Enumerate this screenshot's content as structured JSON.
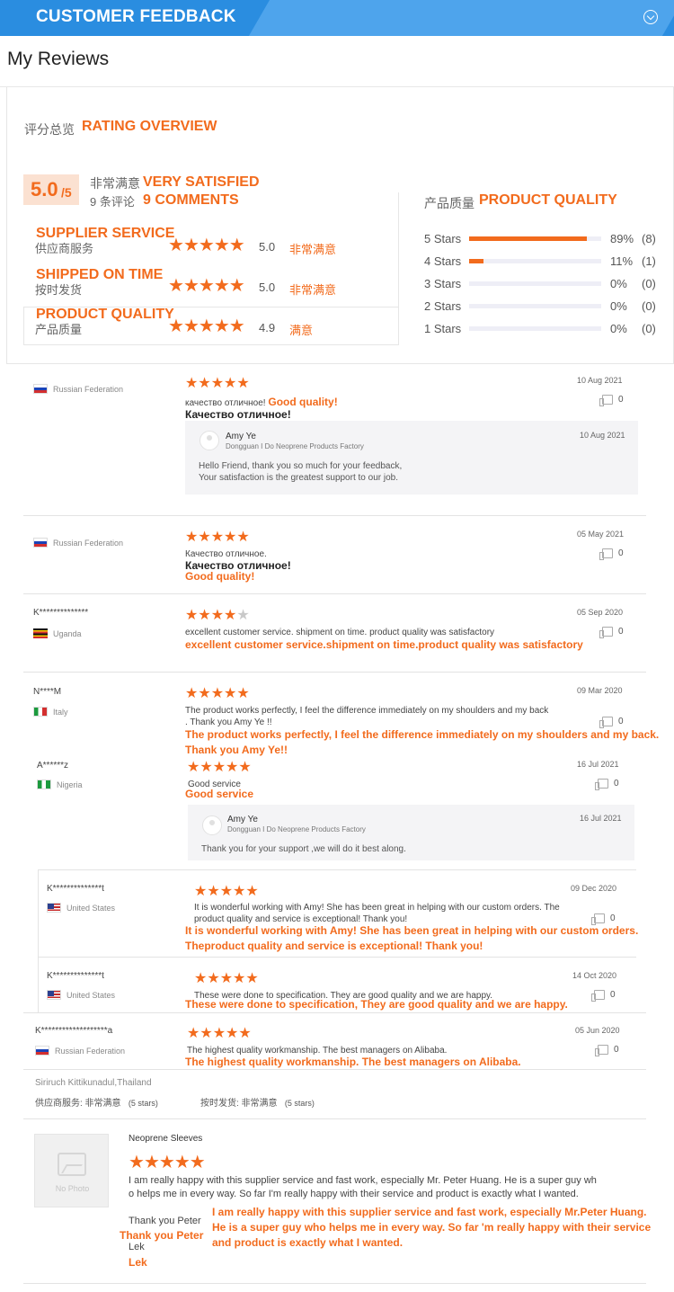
{
  "header": {
    "title": "CUSTOMER FEEDBACK",
    "toggle_icon": "chevron-down-circle-icon"
  },
  "page_title": "My Reviews",
  "overview": {
    "title_cn": "评分总览",
    "title_en": "RATING OVERVIEW",
    "score": "5.0",
    "score_of": "/5",
    "satisfaction_cn": "非常满意",
    "satisfaction_en": "VERY SATISFIED",
    "comments_cn": "9 条评论",
    "comments_en": "9 COMMENTS",
    "ratings": [
      {
        "label_en": "SUPPLIER SERVICE",
        "label_cn": "供应商服务",
        "stars": 5,
        "value": "5.0",
        "status": "非常满意"
      },
      {
        "label_en": "SHIPPED ON TIME",
        "label_cn": "按时发货",
        "stars": 5,
        "value": "5.0",
        "status": "非常满意"
      },
      {
        "label_en": "PRODUCT QUALITY",
        "label_cn": "产品质量",
        "stars": 5,
        "value": "4.9",
        "status": "满意"
      }
    ],
    "product_quality": {
      "title_cn": "产品质量",
      "title_en": "PRODUCT QUALITY",
      "distribution": [
        {
          "label": "5 Stars",
          "fraction": 0.89,
          "percent": "89%",
          "count": "(8)"
        },
        {
          "label": "4 Stars",
          "fraction": 0.11,
          "percent": "11%",
          "count": "(1)"
        },
        {
          "label": "3 Stars",
          "fraction": 0,
          "percent": "0%",
          "count": "(0)"
        },
        {
          "label": "2 Stars",
          "fraction": 0,
          "percent": "0%",
          "count": "(0)"
        },
        {
          "label": "1 Stars",
          "fraction": 0,
          "percent": "0%",
          "count": "(0)"
        }
      ]
    }
  },
  "reviews": [
    {
      "user": "",
      "country": "Russian Federation",
      "stars": 5,
      "date": "10 Aug 2021",
      "likes": "0",
      "comment": "качество отличное!",
      "comment_en": "Good quality!",
      "comment_bold": "Качество отличное!",
      "reply": {
        "name": "Amy Ye",
        "company": "Dongguan I Do Neoprene Products Factory",
        "date": "10 Aug 2021",
        "line1": "Hello Friend, thank you so much for your feedback,",
        "line2": "Your satisfaction is the greatest support to our job."
      }
    },
    {
      "user": "",
      "country": "Russian Federation",
      "stars": 5,
      "date": "05 May 2021",
      "likes": "0",
      "comment": "Качество отличное.",
      "comment_bold": "Качество отличное!",
      "comment_en": "Good quality!"
    },
    {
      "user": "K**************",
      "country": "Uganda",
      "stars": 4,
      "date": "05 Sep 2020",
      "likes": "0",
      "comment": "excellent customer service. shipment on time. product quality was satisfactory",
      "comment_en": "excellent customer service.shipment on time.product quality was satisfactory"
    },
    {
      "user": "N****M",
      "country": "Italy",
      "stars": 5,
      "date": "09 Mar 2020",
      "likes": "0",
      "comment_line1": "The product works perfectly, I feel the difference immediately on my shoulders and my back",
      "comment_line2": ". Thank you Amy Ye !!",
      "comment_en_line1": "The product works perfectly, I feel the difference immediately on my shoulders and my back.",
      "comment_en_line2": "Thank you Amy Ye!!"
    },
    {
      "user": "A******z",
      "country": "Nigeria",
      "stars": 5,
      "date": "16 Jul 2021",
      "likes": "0",
      "comment": "Good service",
      "comment_en": "Good service",
      "reply": {
        "name": "Amy Ye",
        "company": "Dongguan I Do Neoprene Products Factory",
        "date": "16 Jul 2021",
        "line1": "Thank you for your support ,we will do it best along."
      }
    },
    {
      "user": "K**************t",
      "country": "United States",
      "stars": 5,
      "date": "09 Dec 2020",
      "likes": "0",
      "comment_line1": "It is wonderful working with Amy! She has been great in helping with our custom orders. The",
      "comment_line2": "product quality and service is exceptional! Thank you!",
      "comment_en_line1": "It is wonderful working with Amy! She has been great in helping with our custom orders.",
      "comment_en_line2": "Theproduct quality and service is exceptional! Thank you!"
    },
    {
      "user": "K**************t",
      "country": "United States",
      "stars": 5,
      "date": "14 Oct 2020",
      "likes": "0",
      "comment": "These were done to specification. They are good quality and we are happy.",
      "comment_en": "These were done to specification, They are good quality and we are happy."
    },
    {
      "user": "K*******************a",
      "country": "Russian Federation",
      "stars": 5,
      "date": "05 Jun 2020",
      "likes": "0",
      "comment": "The highest quality workmanship. The best managers on Alibaba.",
      "comment_en": "The highest quality workmanship. The best managers on Alibaba."
    }
  ],
  "bottom_review": {
    "reviewer": "Siriruch Kittikunadul,Thailand",
    "supplier_service": "供应商服务: 非常满意",
    "supplier_service_stars": "(5 stars)",
    "shipping": "按时发货: 非常满意",
    "shipping_stars": "(5 stars)",
    "product_title": "Neoprene Sleeves",
    "photo_caption": "No Photo",
    "stars": 5,
    "text_line1": "I am really happy with this supplier service and fast work, especially Mr. Peter Huang. He is a super guy wh",
    "text_line2": "o helps me in every way. So far I'm really happy with their service and product is exactly what I wanted.",
    "thanks": "Thank you Peter",
    "thanks_en": "Thank you Peter",
    "sign": "Lek",
    "sign_en": "Lek",
    "en_line1": "I am really happy with this supplier service and fast work, especially Mr.Peter Huang.",
    "en_line2": "He is a super guy who helps me in every way. So far 'm really happy with their service",
    "en_line3": "and product is exactly what I wanted."
  },
  "colors": {
    "accent": "#f26b1d",
    "header": "#2a8de0",
    "bar_track": "#eeeef6"
  }
}
